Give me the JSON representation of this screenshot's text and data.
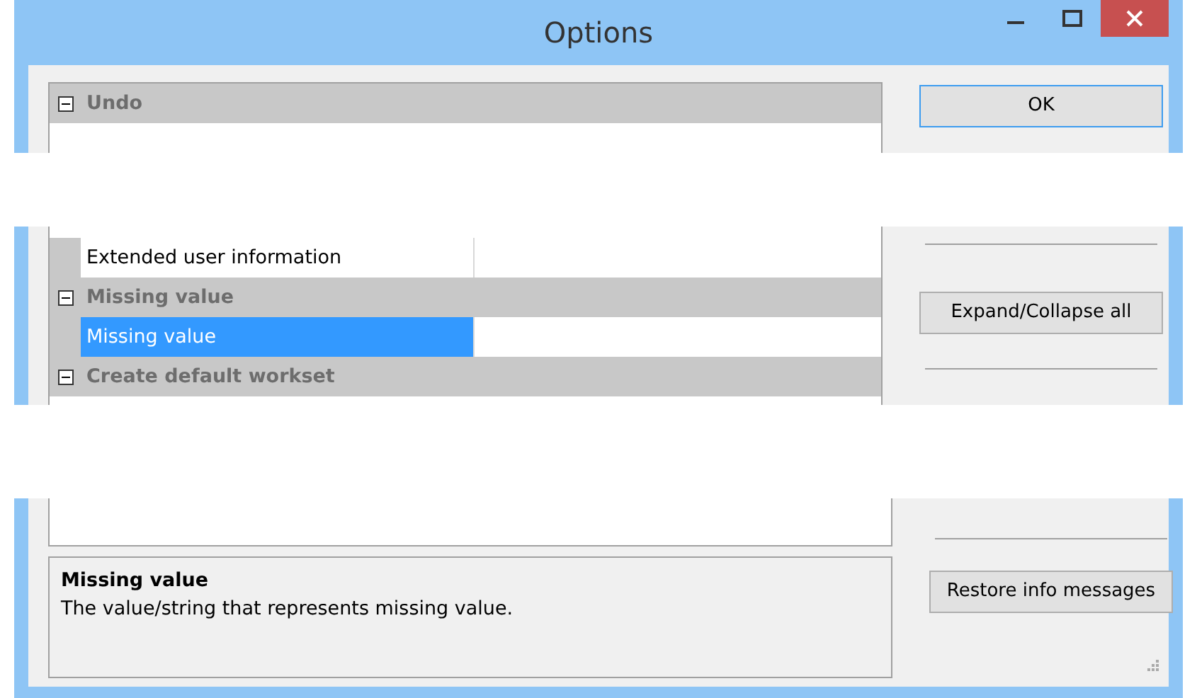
{
  "window": {
    "title": "Options"
  },
  "property_grid": {
    "rows": [
      {
        "kind": "category",
        "label": "Undo",
        "expanded": true
      },
      {
        "kind": "property",
        "label": "Extended user information",
        "selected": false
      },
      {
        "kind": "category",
        "label": "Missing value",
        "expanded": true
      },
      {
        "kind": "property",
        "label": "Missing value",
        "selected": true
      },
      {
        "kind": "category",
        "label": "Create default workset",
        "expanded": true
      }
    ]
  },
  "description": {
    "title": "Missing value",
    "text": "The value/string that represents missing value."
  },
  "buttons": [
    {
      "label": "OK"
    },
    {
      "label": "Expand/Collapse all"
    },
    {
      "label": "Restore info messages"
    }
  ]
}
